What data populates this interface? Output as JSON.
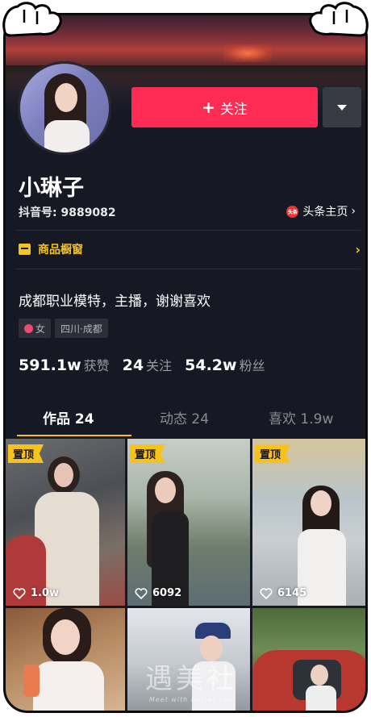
{
  "profile": {
    "follow_label": "关注",
    "follow_plus": "+",
    "nickname": "小琳子",
    "douyin_id": "抖音号: 9889082",
    "toutiao_label": "头条主页",
    "toutiao_badge": "头条",
    "shop_label": "商品橱窗",
    "bio": "成都职业模特，主播，谢谢喜欢",
    "tags": {
      "gender": "女",
      "location": "四川·成都"
    },
    "stats": [
      {
        "num": "591.1w",
        "label": "获赞"
      },
      {
        "num": "24",
        "label": "关注"
      },
      {
        "num": "54.2w",
        "label": "粉丝"
      }
    ]
  },
  "tabs": [
    {
      "label": "作品 24",
      "active": true
    },
    {
      "label": "动态 24",
      "active": false
    },
    {
      "label": "喜欢 1.9w",
      "active": false
    }
  ],
  "grid": [
    {
      "pinned": true,
      "pin_label": "置顶",
      "likes": "1.0w"
    },
    {
      "pinned": true,
      "pin_label": "置顶",
      "likes": "6092"
    },
    {
      "pinned": true,
      "pin_label": "置顶",
      "likes": "6145"
    },
    {
      "pinned": false
    },
    {
      "pinned": false
    },
    {
      "pinned": false
    }
  ],
  "watermark": {
    "text": "遇美社",
    "sub": "Meet with Better you"
  },
  "colors": {
    "bg": "#161823",
    "accent_red": "#fe2c55",
    "accent_yellow": "#f7c21c"
  },
  "icons": [
    "dropdown-arrow-icon",
    "toutiao-icon",
    "chevron-right-icon",
    "shop-icon",
    "female-icon",
    "heart-icon"
  ]
}
